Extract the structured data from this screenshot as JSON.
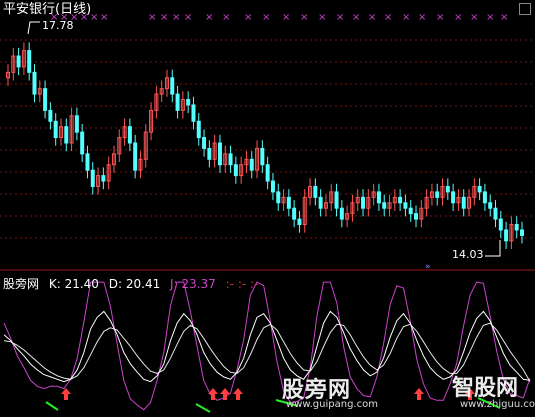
{
  "header": {
    "stock_title": "平安银行(日线)",
    "high_label": "17.78",
    "low_label": "14.03"
  },
  "indicator": {
    "name": "股旁网",
    "k_text": "K: 21.40",
    "d_text": "D: 20.41",
    "j_text": "J: 23.37",
    "dash_text": ":- :- :-"
  },
  "watermark": {
    "brand1": "股旁网",
    "url1": "www.guipang.com",
    "brand2": "智股网",
    "url2": "www.zhiguu.com"
  },
  "colors": {
    "up": "#ff5555",
    "down": "#54ffff",
    "k_line": "#ffffff",
    "d_line": "#e8e8e8",
    "j_line": "#cc44cc",
    "buy_arrow": "#ff4040",
    "green_mark": "#22ee22",
    "top_marker": "#cc44cc",
    "grid": "#7a1515"
  },
  "chart_data": {
    "type": "candlestick",
    "price_range": [
      13.6,
      18.2
    ],
    "high": 17.78,
    "low": 14.03,
    "closes": [
      17.2,
      17.5,
      17.3,
      17.6,
      17.2,
      16.8,
      16.9,
      16.5,
      16.3,
      16.0,
      16.2,
      15.9,
      16.4,
      16.1,
      15.7,
      15.4,
      15.1,
      15.3,
      15.2,
      15.5,
      15.7,
      16.0,
      16.2,
      15.9,
      15.4,
      15.6,
      16.1,
      16.5,
      16.8,
      16.9,
      17.1,
      16.8,
      16.5,
      16.7,
      16.6,
      16.3,
      16.0,
      15.8,
      15.6,
      15.9,
      15.5,
      15.7,
      15.5,
      15.3,
      15.5,
      15.6,
      15.4,
      15.8,
      15.5,
      15.2,
      15.0,
      14.8,
      14.9,
      14.7,
      14.5,
      14.4,
      14.9,
      15.1,
      14.9,
      14.7,
      14.8,
      15.0,
      14.7,
      14.5,
      14.6,
      14.8,
      14.9,
      14.7,
      14.9,
      15.0,
      14.8,
      14.7,
      14.8,
      14.9,
      14.8,
      14.7,
      14.6,
      14.5,
      14.7,
      14.9,
      15.0,
      14.9,
      15.1,
      15.0,
      14.8,
      14.9,
      14.7,
      14.9,
      15.1,
      15.0,
      14.8,
      14.7,
      14.5,
      14.3,
      14.1,
      14.4,
      14.3,
      14.2
    ],
    "k_values": [
      60,
      55,
      48,
      42,
      35,
      30,
      26,
      24,
      22,
      20,
      22,
      30,
      45,
      65,
      75,
      80,
      72,
      60,
      45,
      35,
      28,
      22,
      20,
      25,
      35,
      55,
      70,
      78,
      72,
      60,
      45,
      35,
      28,
      24,
      22,
      28,
      40,
      60,
      75,
      78,
      70,
      55,
      40,
      30,
      25,
      22,
      30,
      50,
      70,
      80,
      75,
      62,
      48,
      38,
      30,
      25,
      28,
      40,
      58,
      72,
      78,
      70,
      55,
      42,
      32,
      26,
      22,
      24,
      30,
      45,
      62,
      74,
      80,
      72,
      58,
      44,
      34,
      28,
      22,
      21
    ],
    "d_values": [
      55,
      54,
      51,
      47,
      42,
      37,
      32,
      28,
      25,
      23,
      22,
      25,
      32,
      43,
      54,
      63,
      66,
      64,
      57,
      50,
      42,
      35,
      29,
      27,
      30,
      40,
      52,
      63,
      68,
      65,
      57,
      48,
      40,
      33,
      28,
      27,
      32,
      43,
      56,
      66,
      69,
      64,
      54,
      44,
      36,
      30,
      29,
      37,
      50,
      62,
      69,
      68,
      60,
      50,
      41,
      34,
      30,
      34,
      44,
      57,
      67,
      69,
      63,
      54,
      45,
      37,
      31,
      27,
      27,
      34,
      46,
      58,
      68,
      70,
      64,
      55,
      46,
      38,
      30,
      20
    ]
  }
}
